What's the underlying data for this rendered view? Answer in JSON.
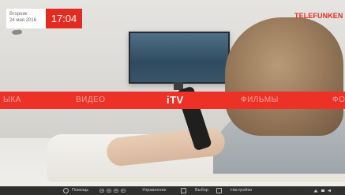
{
  "date": {
    "weekday": "Вторник",
    "date": "24 мая 2016"
  },
  "time": "17:04",
  "brand": "TELEFUNKEN",
  "menu": {
    "items": [
      {
        "label": "ЫКА"
      },
      {
        "label": "ВИДЕО"
      },
      {
        "label": "iTV"
      },
      {
        "label": "ФИЛЬМЫ"
      },
      {
        "label": "ФО"
      }
    ],
    "active_label": "iTV"
  },
  "hints": {
    "help": "Помощь",
    "control": "Управление",
    "select": "Выбор",
    "settings": "Настройки"
  },
  "colors": {
    "accent": "#ee3127",
    "clock_bg": "#e52b21",
    "bottom_bg": "#141414"
  },
  "icons": [
    "weather-cloud-icon",
    "key-icon",
    "arrow-left-icon",
    "arrow-up-icon",
    "arrow-down-icon",
    "arrow-right-icon",
    "ok-icon",
    "menu-icon",
    "network-icon",
    "usb-icon",
    "volume-icon"
  ]
}
